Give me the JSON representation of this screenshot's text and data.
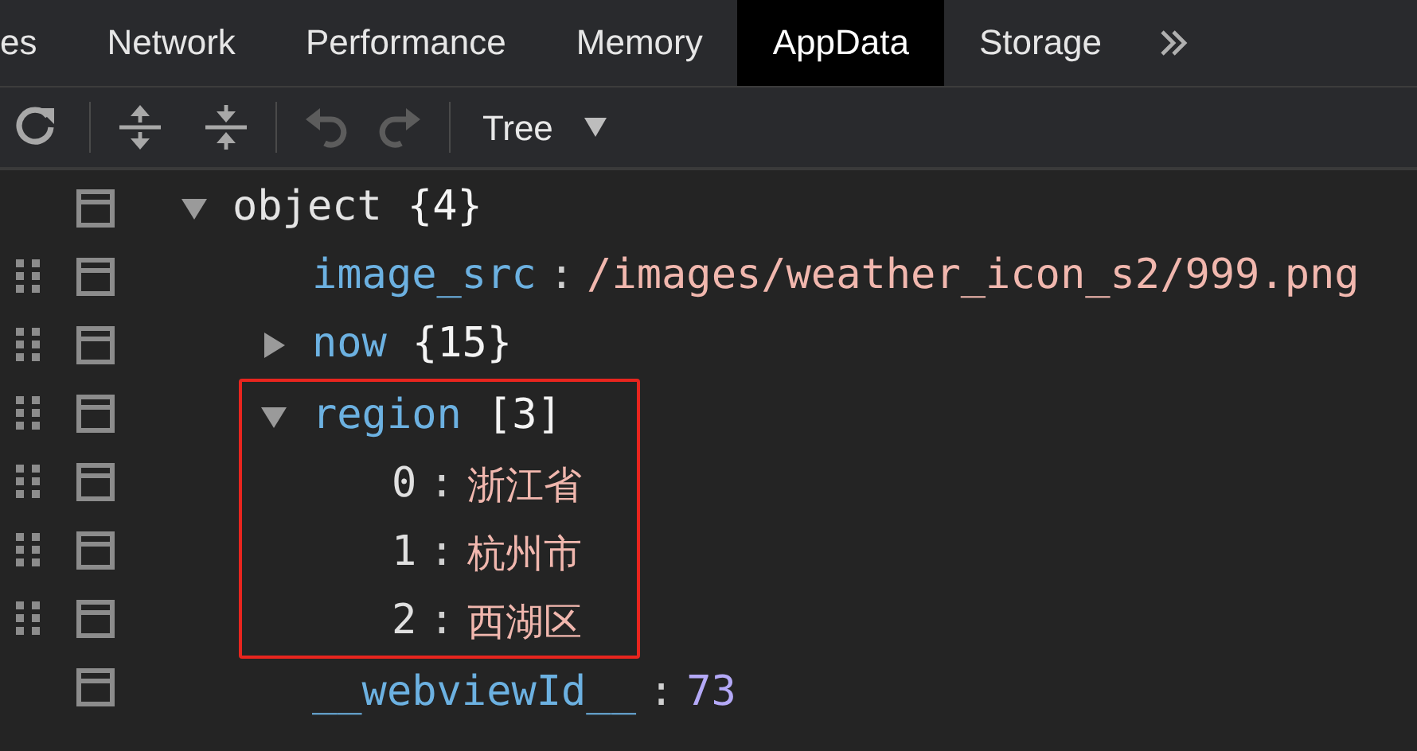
{
  "tabs": [
    {
      "label": "es",
      "selected": false
    },
    {
      "label": "Network",
      "selected": false
    },
    {
      "label": "Performance",
      "selected": false
    },
    {
      "label": "Memory",
      "selected": false
    },
    {
      "label": "AppData",
      "selected": true
    },
    {
      "label": "Storage",
      "selected": false
    }
  ],
  "toolbar": {
    "buttons": [
      {
        "kind": "refresh",
        "disabled": false
      },
      {
        "kind": "expand",
        "disabled": false
      },
      {
        "kind": "collapse",
        "disabled": false
      },
      {
        "kind": "undo",
        "disabled": true
      },
      {
        "kind": "redo",
        "disabled": true
      }
    ],
    "view_select": {
      "value": "Tree"
    }
  },
  "tree": {
    "key": "object",
    "kind": "object",
    "summary": "{4}",
    "expanded": true,
    "draggable": false,
    "children": [
      {
        "key": "image_src",
        "kind": "string",
        "separator": ":",
        "value": "/images/weather_icon_s2/999.png",
        "draggable": true
      },
      {
        "key": "now",
        "kind": "object",
        "summary": "{15}",
        "expanded": false,
        "draggable": true
      },
      {
        "key": "region",
        "kind": "array",
        "summary": "[3]",
        "expanded": true,
        "draggable": true,
        "highlighted": true,
        "children": [
          {
            "key": "0",
            "kind": "string",
            "separator": ":",
            "value": "浙江省",
            "draggable": true
          },
          {
            "key": "1",
            "kind": "string",
            "separator": ":",
            "value": "杭州市",
            "draggable": true
          },
          {
            "key": "2",
            "kind": "string",
            "separator": ":",
            "value": "西湖区",
            "draggable": true
          }
        ]
      },
      {
        "key": "__webviewId__",
        "kind": "number",
        "separator": ":",
        "value": "73",
        "draggable": false
      }
    ]
  }
}
